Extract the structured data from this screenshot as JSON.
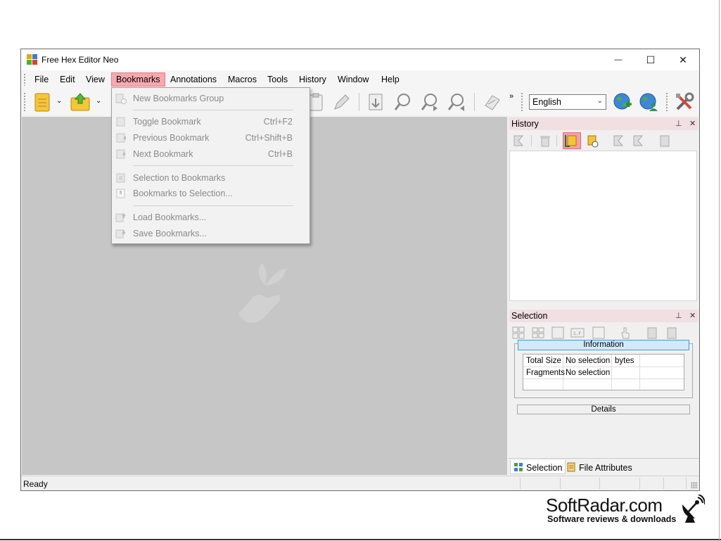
{
  "window": {
    "title": "Free Hex Editor Neo",
    "minimize_glyph": "—",
    "maximize_glyph": "☐",
    "close_glyph": "✕"
  },
  "menubar": {
    "items": [
      "File",
      "Edit",
      "View",
      "Bookmarks",
      "Annotations",
      "Macros",
      "Tools",
      "History",
      "Window",
      "Help"
    ],
    "active": "Bookmarks"
  },
  "toolbar": {
    "language": "English",
    "icons": [
      "new-file-icon",
      "open-file-icon",
      "clipboard-icon",
      "pencil-icon",
      "save-icon",
      "find-icon",
      "find-next-icon",
      "find-previous-icon",
      "bookmark-tool-icon",
      "globe-icon",
      "globe-user-icon",
      "tools-icon"
    ]
  },
  "bookmarks_menu": {
    "items": [
      {
        "label": "New Bookmarks Group",
        "shortcut": ""
      },
      {
        "label": "Toggle Bookmark",
        "shortcut": "Ctrl+F2"
      },
      {
        "label": "Previous Bookmark",
        "shortcut": "Ctrl+Shift+B"
      },
      {
        "label": "Next Bookmark",
        "shortcut": "Ctrl+B"
      },
      {
        "label": "Selection to Bookmarks",
        "shortcut": ""
      },
      {
        "label": "Bookmarks to Selection...",
        "shortcut": ""
      },
      {
        "label": "Load Bookmarks...",
        "shortcut": ""
      },
      {
        "label": "Save Bookmarks...",
        "shortcut": ""
      }
    ]
  },
  "history_panel": {
    "title": "History",
    "pin_glyph": "⊥",
    "close_glyph": "✕"
  },
  "selection_panel": {
    "title": "Selection",
    "information_label": "Information",
    "rows": [
      {
        "label": "Total Size",
        "value": "No selection",
        "unit": "bytes"
      },
      {
        "label": "Fragments",
        "value": "No selection",
        "unit": ""
      }
    ],
    "details_label": "Details"
  },
  "bottom_tabs": {
    "selection": "Selection",
    "file_attributes": "File Attributes"
  },
  "status": {
    "text": "Ready"
  },
  "brand": {
    "name": "SoftRadar.com",
    "tagline": "Software reviews & downloads"
  }
}
